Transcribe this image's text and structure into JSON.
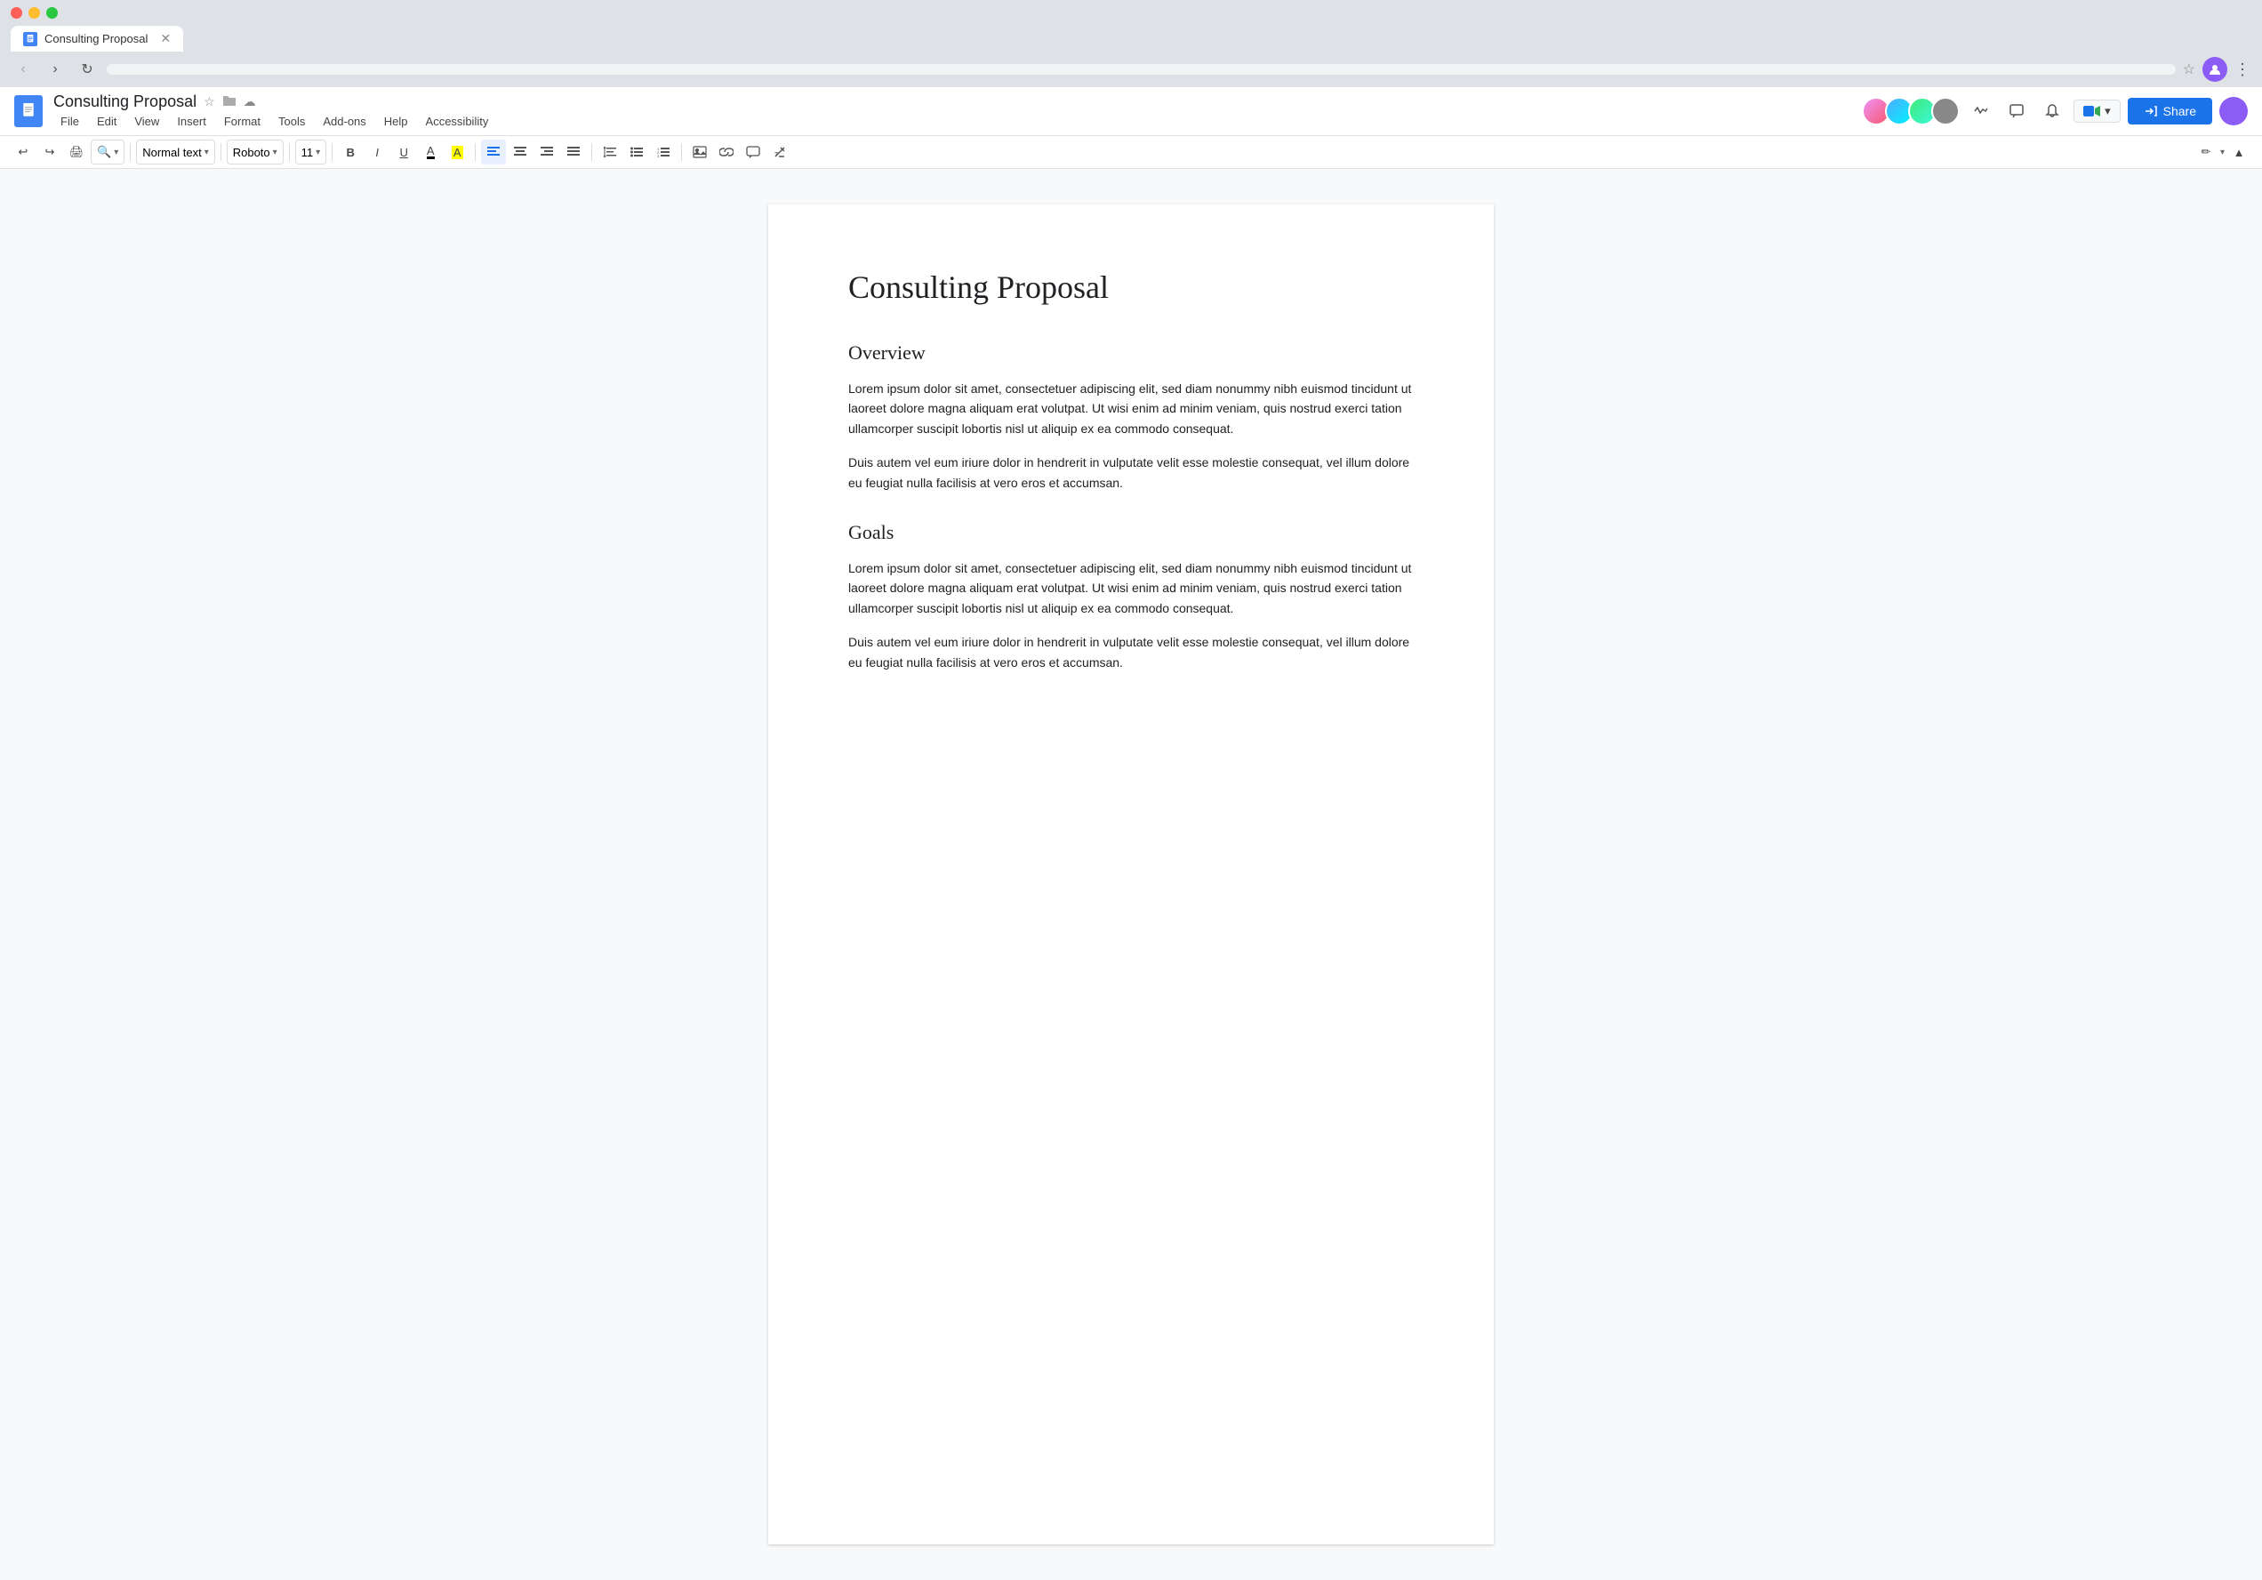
{
  "browser": {
    "tab": {
      "title": "Consulting Proposal",
      "favicon_label": "docs-icon"
    },
    "nav": {
      "back_label": "‹",
      "forward_label": "›",
      "refresh_label": "↻"
    },
    "omnibox": {
      "url": ""
    }
  },
  "app": {
    "doc_title": "Consulting Proposal",
    "menu_items": [
      "File",
      "Edit",
      "View",
      "Insert",
      "Format",
      "Tools",
      "Add-ons",
      "Help",
      "Accessibility"
    ],
    "toolbar": {
      "style_dropdown": "Normal text",
      "font_dropdown": "Roboto",
      "size_dropdown": "11",
      "bold_label": "B",
      "italic_label": "I",
      "underline_label": "U"
    },
    "share_button": "Share",
    "meet_button": "Meet"
  },
  "document": {
    "title": "Consulting Proposal",
    "sections": [
      {
        "heading": "Overview",
        "paragraphs": [
          "Lorem ipsum dolor sit amet, consectetuer adipiscing elit, sed diam nonummy nibh euismod tincidunt ut laoreet dolore magna aliquam erat volutpat. Ut wisi enim ad minim veniam, quis nostrud exerci tation ullamcorper suscipit lobortis nisl ut aliquip ex ea commodo consequat.",
          "Duis autem vel eum iriure dolor in hendrerit in vulputate velit esse molestie consequat, vel illum dolore eu feugiat nulla facilisis at vero eros et accumsan."
        ]
      },
      {
        "heading": "Goals",
        "paragraphs": [
          "Lorem ipsum dolor sit amet, consectetuer adipiscing elit, sed diam nonummy nibh euismod tincidunt ut laoreet dolore magna aliquam erat volutpat. Ut wisi enim ad minim veniam, quis nostrud exerci tation ullamcorper suscipit lobortis nisl ut aliquip ex ea commodo consequat.",
          "Duis autem vel eum iriure dolor in hendrerit in vulputate velit esse molestie consequat, vel illum dolore eu feugiat nulla facilisis at vero eros et accumsan."
        ]
      }
    ]
  }
}
